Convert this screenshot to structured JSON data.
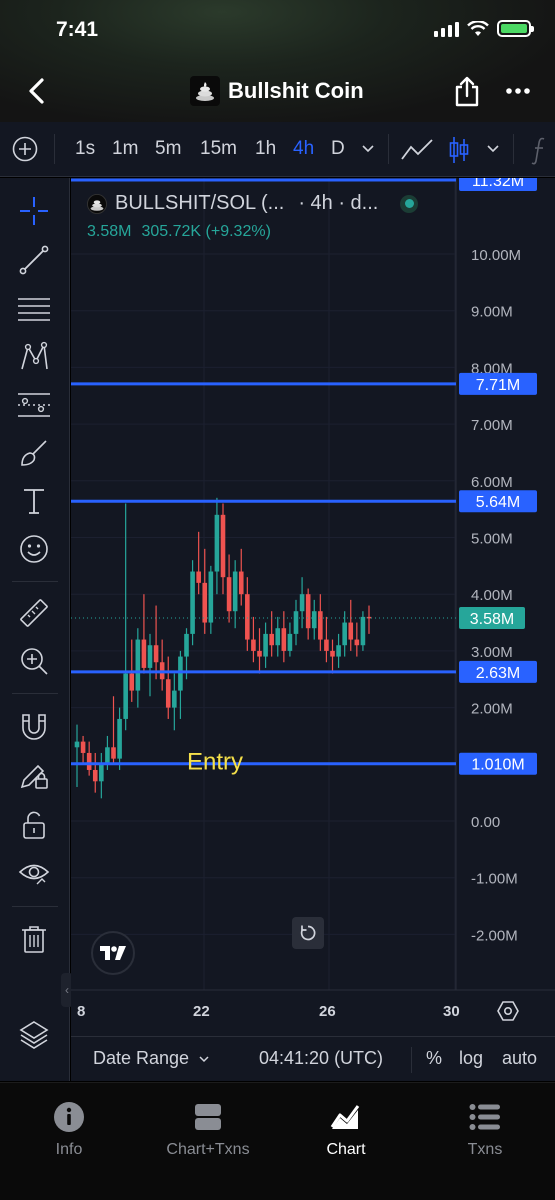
{
  "status": {
    "time": "7:41"
  },
  "header": {
    "title": "Bullshit Coin"
  },
  "toolbar": {
    "timeframes": [
      "1s",
      "1m",
      "5m",
      "15m",
      "1h",
      "4h",
      "D"
    ],
    "active_timeframe": "4h"
  },
  "legend": {
    "symbol": "BULLSHIT/SOL (...",
    "interval": "· 4h · d...",
    "last_price": "3.58M",
    "change": "305.72K (+9.32%)"
  },
  "chart_data": {
    "type": "candlestick",
    "y_ticks": [
      "10.00M",
      "9.00M",
      "8.00M",
      "7.00M",
      "6.00M",
      "5.00M",
      "4.00M",
      "3.00M",
      "2.00M",
      "1.00M",
      "0.00",
      "-1.00M",
      "-2.00M"
    ],
    "y_tick_values": [
      10,
      9,
      8,
      7,
      6,
      5,
      4,
      3,
      2,
      1,
      0,
      -1,
      -2
    ],
    "x_ticks": [
      "8",
      "22",
      "26",
      "30"
    ],
    "y_unit": "M",
    "price_lines": [
      {
        "label": "11.32M",
        "value": 11.32
      },
      {
        "label": "7.71M",
        "value": 7.71
      },
      {
        "label": "5.64M",
        "value": 5.64
      },
      {
        "label": "2.63M",
        "value": 2.63
      },
      {
        "label": "1.010M",
        "value": 1.01
      }
    ],
    "current_price": {
      "label": "3.58M",
      "value": 3.58
    },
    "annotation": "Entry",
    "candles": [
      {
        "o": 1.3,
        "h": 1.7,
        "l": 0.6,
        "c": 1.4
      },
      {
        "o": 1.4,
        "h": 1.5,
        "l": 1.0,
        "c": 1.2
      },
      {
        "o": 1.2,
        "h": 1.4,
        "l": 0.8,
        "c": 0.9
      },
      {
        "o": 0.9,
        "h": 1.2,
        "l": 0.5,
        "c": 0.7
      },
      {
        "o": 0.7,
        "h": 1.2,
        "l": 0.4,
        "c": 1.0
      },
      {
        "o": 1.0,
        "h": 1.5,
        "l": 0.9,
        "c": 1.3
      },
      {
        "o": 1.3,
        "h": 2.2,
        "l": 1.0,
        "c": 1.1
      },
      {
        "o": 1.1,
        "h": 2.0,
        "l": 0.9,
        "c": 1.8
      },
      {
        "o": 1.8,
        "h": 5.6,
        "l": 1.6,
        "c": 2.6
      },
      {
        "o": 2.6,
        "h": 3.2,
        "l": 2.1,
        "c": 2.3
      },
      {
        "o": 2.3,
        "h": 3.4,
        "l": 2.0,
        "c": 3.2
      },
      {
        "o": 3.2,
        "h": 4.0,
        "l": 2.6,
        "c": 2.7
      },
      {
        "o": 2.7,
        "h": 3.3,
        "l": 2.2,
        "c": 3.1
      },
      {
        "o": 3.1,
        "h": 3.8,
        "l": 2.5,
        "c": 2.8
      },
      {
        "o": 2.8,
        "h": 3.2,
        "l": 2.3,
        "c": 2.5
      },
      {
        "o": 2.5,
        "h": 2.9,
        "l": 1.8,
        "c": 2.0
      },
      {
        "o": 2.0,
        "h": 2.6,
        "l": 1.6,
        "c": 2.3
      },
      {
        "o": 2.3,
        "h": 3.0,
        "l": 1.8,
        "c": 2.9
      },
      {
        "o": 2.9,
        "h": 3.4,
        "l": 2.5,
        "c": 3.3
      },
      {
        "o": 3.3,
        "h": 4.6,
        "l": 3.1,
        "c": 4.4
      },
      {
        "o": 4.4,
        "h": 5.1,
        "l": 4.0,
        "c": 4.2
      },
      {
        "o": 4.2,
        "h": 4.8,
        "l": 3.3,
        "c": 3.5
      },
      {
        "o": 3.5,
        "h": 4.5,
        "l": 3.3,
        "c": 4.4
      },
      {
        "o": 4.4,
        "h": 5.7,
        "l": 4.0,
        "c": 5.4
      },
      {
        "o": 5.4,
        "h": 5.6,
        "l": 4.0,
        "c": 4.3
      },
      {
        "o": 4.3,
        "h": 4.7,
        "l": 3.5,
        "c": 3.7
      },
      {
        "o": 3.7,
        "h": 4.6,
        "l": 3.4,
        "c": 4.4
      },
      {
        "o": 4.4,
        "h": 4.8,
        "l": 3.8,
        "c": 4.0
      },
      {
        "o": 4.0,
        "h": 4.3,
        "l": 3.0,
        "c": 3.2
      },
      {
        "o": 3.2,
        "h": 3.6,
        "l": 2.8,
        "c": 3.0
      },
      {
        "o": 3.0,
        "h": 3.4,
        "l": 2.6,
        "c": 2.9
      },
      {
        "o": 2.9,
        "h": 3.5,
        "l": 2.7,
        "c": 3.3
      },
      {
        "o": 3.3,
        "h": 3.7,
        "l": 2.9,
        "c": 3.1
      },
      {
        "o": 3.1,
        "h": 3.6,
        "l": 2.9,
        "c": 3.4
      },
      {
        "o": 3.4,
        "h": 3.7,
        "l": 2.8,
        "c": 3.0
      },
      {
        "o": 3.0,
        "h": 3.5,
        "l": 2.9,
        "c": 3.3
      },
      {
        "o": 3.3,
        "h": 3.9,
        "l": 3.1,
        "c": 3.7
      },
      {
        "o": 3.7,
        "h": 4.3,
        "l": 3.4,
        "c": 4.0
      },
      {
        "o": 4.0,
        "h": 4.1,
        "l": 3.2,
        "c": 3.4
      },
      {
        "o": 3.4,
        "h": 3.9,
        "l": 3.2,
        "c": 3.7
      },
      {
        "o": 3.7,
        "h": 4.0,
        "l": 3.0,
        "c": 3.2
      },
      {
        "o": 3.2,
        "h": 3.6,
        "l": 2.8,
        "c": 3.0
      },
      {
        "o": 3.0,
        "h": 3.2,
        "l": 2.6,
        "c": 2.9
      },
      {
        "o": 2.9,
        "h": 3.3,
        "l": 2.7,
        "c": 3.1
      },
      {
        "o": 3.1,
        "h": 3.7,
        "l": 2.9,
        "c": 3.5
      },
      {
        "o": 3.5,
        "h": 3.9,
        "l": 3.0,
        "c": 3.2
      },
      {
        "o": 3.2,
        "h": 3.5,
        "l": 2.9,
        "c": 3.1
      },
      {
        "o": 3.1,
        "h": 3.7,
        "l": 3.0,
        "c": 3.6
      },
      {
        "o": 3.6,
        "h": 3.8,
        "l": 3.3,
        "c": 3.58
      }
    ]
  },
  "bottom_bar": {
    "date_range": "Date Range",
    "utc_time": "04:41:20 (UTC)",
    "percent": "%",
    "log": "log",
    "auto": "auto"
  },
  "nav": [
    {
      "label": "Info",
      "icon": "info-icon"
    },
    {
      "label": "Chart+Txns",
      "icon": "split-view-icon"
    },
    {
      "label": "Chart",
      "icon": "chart-icon",
      "active": true
    },
    {
      "label": "Txns",
      "icon": "list-icon"
    }
  ],
  "colors": {
    "up": "#26a69a",
    "down": "#ef5350",
    "line": "#2962ff",
    "entry": "#f5e04a"
  }
}
